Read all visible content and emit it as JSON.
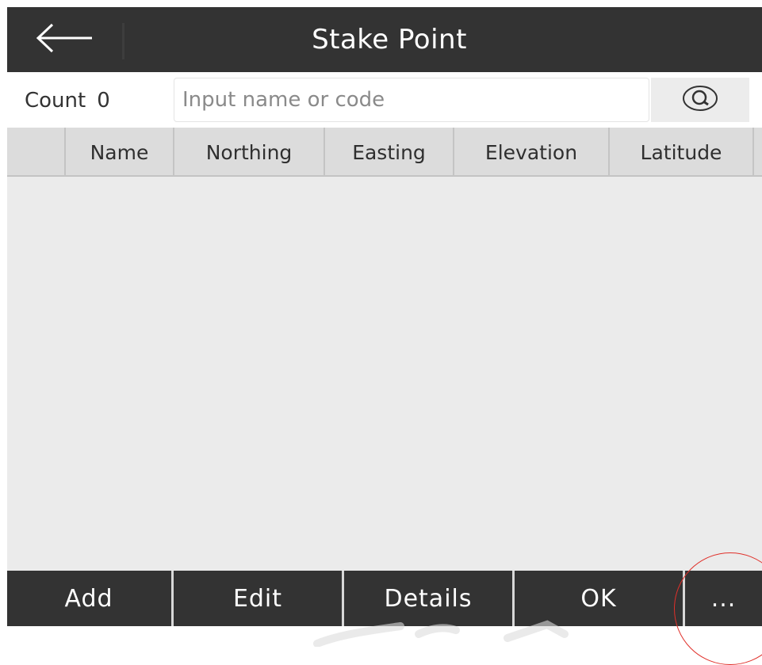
{
  "header": {
    "title": "Stake Point",
    "back_icon": "arrow-left-icon"
  },
  "search": {
    "count_label": "Count",
    "count_value": "0",
    "placeholder": "Input name or code",
    "value": "",
    "search_icon": "search-icon"
  },
  "table": {
    "columns": [
      "Name",
      "Northing",
      "Easting",
      "Elevation",
      "Latitude"
    ],
    "rows": []
  },
  "toolbar": {
    "buttons": [
      "Add",
      "Edit",
      "Details",
      "OK",
      "..."
    ]
  },
  "colors": {
    "header_bg": "#333333",
    "toolbar_bg": "#333333",
    "table_header_bg": "#dcdcdc",
    "table_body_bg": "#ebebeb",
    "highlight": "#e0302a"
  }
}
